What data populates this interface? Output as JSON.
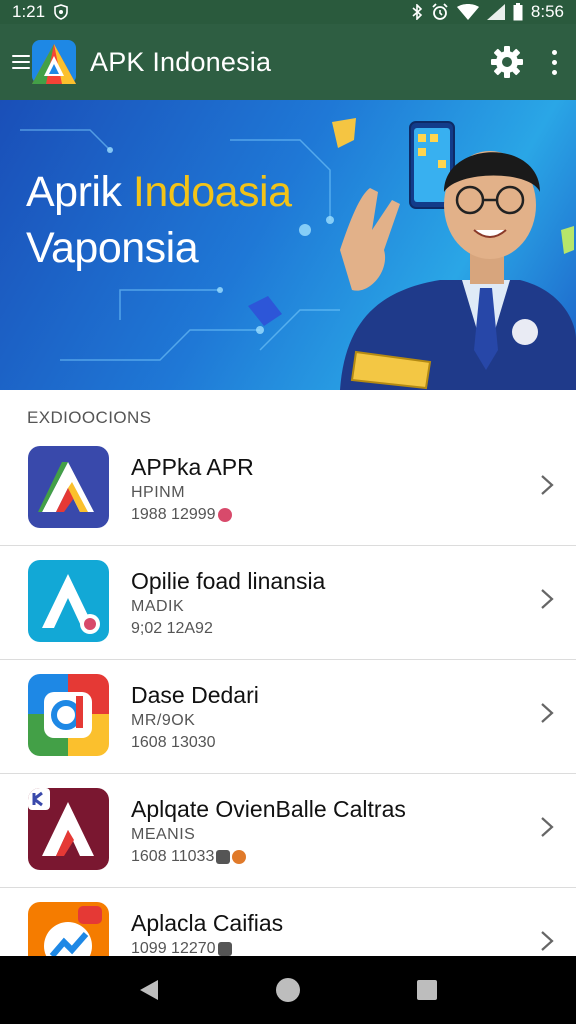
{
  "status_bar": {
    "time": "1:21",
    "clock": "8:56",
    "icons": [
      "shield-icon",
      "bluetooth-icon",
      "alarm-icon",
      "wifi-icon",
      "signal-icon",
      "battery-icon"
    ]
  },
  "app_bar": {
    "title": "APK Indonesia",
    "icons": [
      "hamburger-icon",
      "app-logo",
      "gear-icon",
      "more-vert-icon"
    ]
  },
  "banner": {
    "line1_white": "Aprik ",
    "line1_accent": "Indoasia",
    "line2": "Vaponsia",
    "accent_color": "#f2c318"
  },
  "section": {
    "title": "EXDIOOCIONS"
  },
  "apps": [
    {
      "name": "APPka APR",
      "developer": "HPINM",
      "meta": "1988 12999",
      "icon": "blue-a-logo-icon"
    },
    {
      "name": "Opilie foad linansia",
      "developer": "MADIK",
      "meta": "9;02 12A92",
      "icon": "cyan-a-logo-icon"
    },
    {
      "name": "Dase Dedari",
      "developer": "MR/9OK",
      "meta": "1608 13030",
      "icon": "colorful-d-logo-icon"
    },
    {
      "name": "Aplqate OvienBalle Caltras",
      "developer": "MEANIS",
      "meta": "1608 11033",
      "icon": "maroon-a-logo-icon"
    },
    {
      "name": "Aplacla Caifias",
      "developer": "",
      "meta": "1099 12270",
      "icon": "orange-chart-logo-icon"
    }
  ],
  "nav": {
    "icons": [
      "back-icon",
      "home-icon",
      "recents-icon"
    ]
  },
  "colors": {
    "app_bar": "#2e5e42",
    "status_bar": "#2a5a3d",
    "banner_blue": "#1f78d6"
  }
}
